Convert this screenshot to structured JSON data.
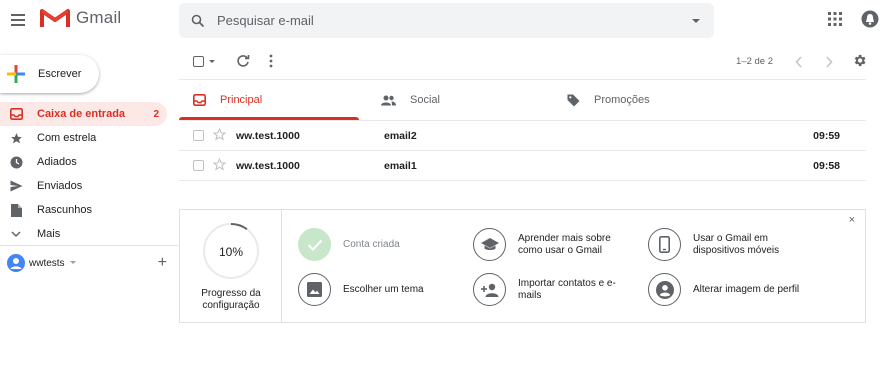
{
  "header": {
    "app_name": "Gmail",
    "search_placeholder": "Pesquisar e-mail"
  },
  "compose": {
    "label": "Escrever"
  },
  "sidebar": {
    "items": [
      {
        "label": "Caixa de entrada",
        "count": "2",
        "icon": "inbox-icon",
        "active": true
      },
      {
        "label": "Com estrela",
        "count": "",
        "icon": "star-icon"
      },
      {
        "label": "Adiados",
        "count": "",
        "icon": "clock-icon"
      },
      {
        "label": "Enviados",
        "count": "",
        "icon": "send-icon"
      },
      {
        "label": "Rascunhos",
        "count": "",
        "icon": "draft-icon"
      },
      {
        "label": "Mais",
        "count": "",
        "icon": "chevron-down-icon"
      }
    ],
    "user": {
      "name": "wwtests"
    }
  },
  "toolbar": {
    "pager": "1–2 de 2"
  },
  "tabs": [
    {
      "label": "Principal",
      "icon": "inbox-icon",
      "active": true
    },
    {
      "label": "Social",
      "icon": "people-icon"
    },
    {
      "label": "Promoções",
      "icon": "tag-icon"
    }
  ],
  "emails": [
    {
      "from": "ww.test.1000",
      "subject": "email2",
      "time": "09:59"
    },
    {
      "from": "ww.test.1000",
      "subject": "email1",
      "time": "09:58"
    }
  ],
  "setup": {
    "close": "×",
    "progress": {
      "percent": "10%",
      "value": 0.1,
      "label": "Progresso da configuração"
    },
    "steps": [
      {
        "label": "Conta criada",
        "done": true,
        "icon": "check-icon"
      },
      {
        "label": "Aprender mais sobre como usar o Gmail",
        "icon": "school-icon"
      },
      {
        "label": "Usar o Gmail em dispositivos móveis",
        "icon": "phone-icon"
      },
      {
        "label": "Escolher um tema",
        "icon": "image-icon"
      },
      {
        "label": "Importar contatos e e-mails",
        "icon": "add-person-icon"
      },
      {
        "label": "Alterar imagem de perfil",
        "icon": "account-circle-icon"
      }
    ]
  },
  "colors": {
    "accent": "#d93025",
    "active_bg": "#fce8e6",
    "done_green": "#c8e6c9"
  }
}
